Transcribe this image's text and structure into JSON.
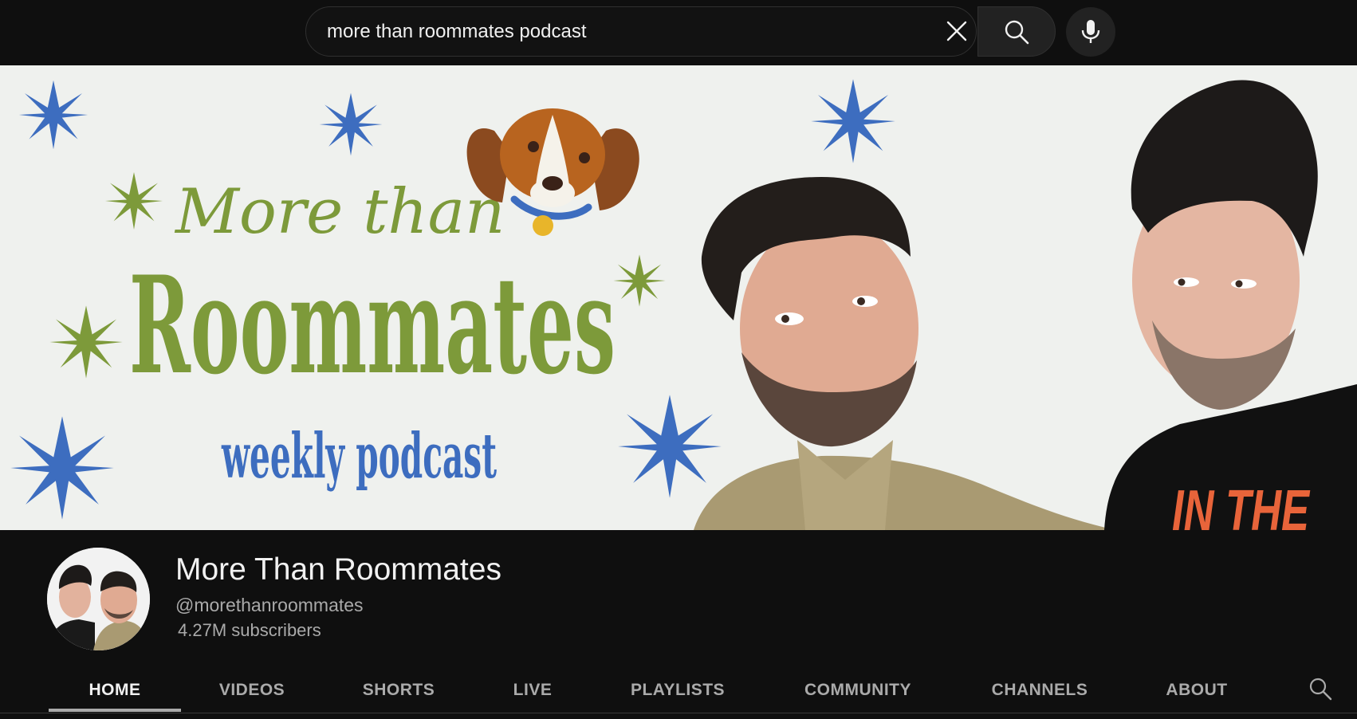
{
  "search": {
    "query": "more than roommates podcast",
    "clear_icon": "close-icon",
    "search_icon": "search-icon",
    "mic_icon": "microphone-icon"
  },
  "banner": {
    "logo_script": "More than",
    "logo_title": "Roommates",
    "tagline": "weekly podcast",
    "shirt_text": "IN THE",
    "colors": {
      "background": "#eff1ee",
      "green": "#7d9a3a",
      "blue": "#3d6dbf"
    }
  },
  "channel": {
    "name": "More Than Roommates",
    "handle": "@morethanroommates",
    "subscribers": "4.27M subscribers"
  },
  "tabs": [
    {
      "label": "HOME",
      "active": true
    },
    {
      "label": "VIDEOS",
      "active": false
    },
    {
      "label": "SHORTS",
      "active": false
    },
    {
      "label": "LIVE",
      "active": false
    },
    {
      "label": "PLAYLISTS",
      "active": false
    },
    {
      "label": "COMMUNITY",
      "active": false
    },
    {
      "label": "CHANNELS",
      "active": false
    },
    {
      "label": "ABOUT",
      "active": false
    }
  ],
  "tab_search_icon": "search-icon"
}
